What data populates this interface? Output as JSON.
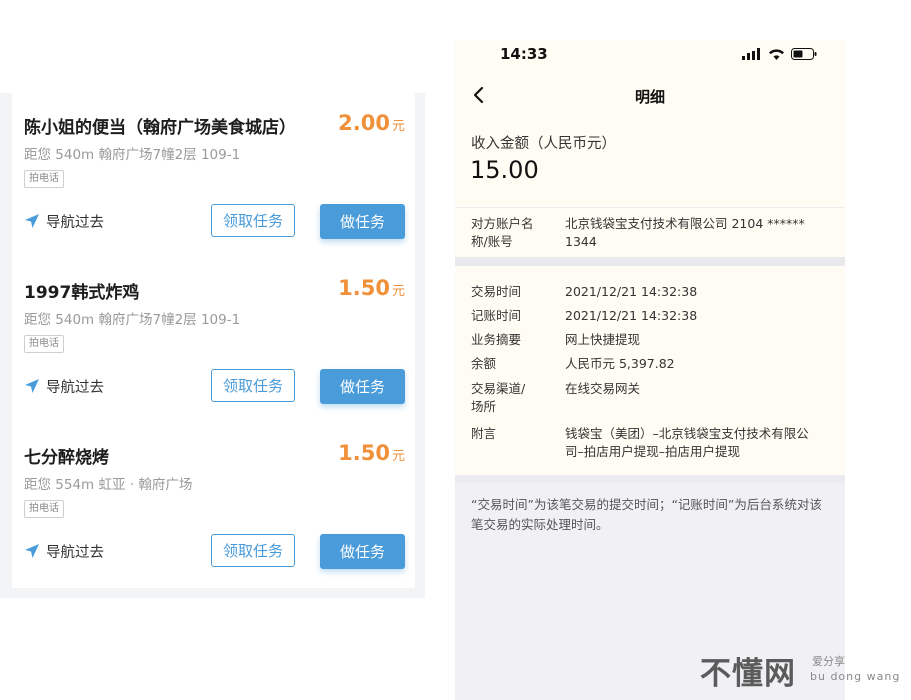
{
  "tasks": [
    {
      "name": "陈小姐的便当（翰府广场美食城店）",
      "price": "2.00",
      "unit": "元",
      "address": "距您 540m   翰府广场7幢2层 109-1",
      "tag": "拍电话",
      "nav": "导航过去",
      "claim": "领取任务",
      "do": "做任务"
    },
    {
      "name": "1997韩式炸鸡",
      "price": "1.50",
      "unit": "元",
      "address": "距您 540m   翰府广场7幢2层 109-1",
      "tag": "拍电话",
      "nav": "导航过去",
      "claim": "领取任务",
      "do": "做任务"
    },
    {
      "name": "七分醉烧烤",
      "price": "1.50",
      "unit": "元",
      "address": "距您 554m   虹亚 · 翰府广场",
      "tag": "拍电话",
      "nav": "导航过去",
      "claim": "领取任务",
      "do": "做任务"
    }
  ],
  "phone": {
    "time": "14:33",
    "title": "明细",
    "amount_label": "收入金额（人民币元）",
    "amount": "15.00",
    "counterparty_label": "对方账户名称/账号",
    "counterparty_value": "北京钱袋宝支付技术有限公司 2104 ****** 1344",
    "rows": [
      {
        "label": "交易时间",
        "value": "2021/12/21   14:32:38"
      },
      {
        "label": "记账时间",
        "value": "2021/12/21   14:32:38"
      },
      {
        "label": "业务摘要",
        "value": "网上快捷提现"
      },
      {
        "label": "余额",
        "value": "人民币元 5,397.82"
      },
      {
        "label": "交易渠道/场所",
        "value": "在线交易网关"
      },
      {
        "label": "附言",
        "value": "钱袋宝（美团）–北京钱袋宝支付技术有限公司–拍店用户提现–拍店用户提现"
      }
    ],
    "note": "“交易时间”为该笔交易的提交时间；“记账时间”为后台系统对该笔交易的实际处理时间。"
  },
  "watermark": {
    "main": "不懂网",
    "sub1": "爱分享",
    "sub2": "bu dong wang"
  },
  "colors": {
    "accent_blue": "#4a9bd9",
    "price_orange": "#f0913a"
  }
}
